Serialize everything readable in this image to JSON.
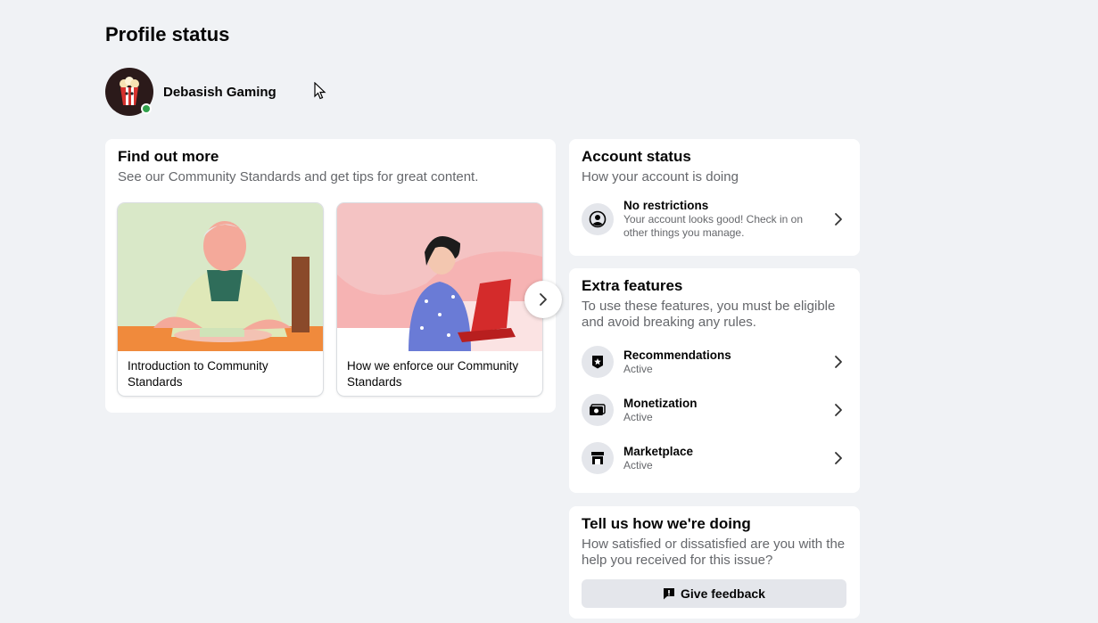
{
  "page": {
    "title": "Profile status"
  },
  "profile": {
    "name": "Debasish Gaming",
    "status_color": "#31a24c"
  },
  "find_out_more": {
    "title": "Find out more",
    "subtitle": "See our Community Standards and get tips for great content.",
    "tiles": [
      {
        "label": "Introduction to Community Standards",
        "image": "elderly-man-reading-illustration"
      },
      {
        "label": "How we enforce our Community Standards",
        "image": "woman-laptop-illustration"
      }
    ],
    "next_icon": "chevron-right-icon"
  },
  "account_status": {
    "title": "Account status",
    "subtitle": "How your account is doing",
    "item": {
      "title": "No restrictions",
      "description": "Your account looks good! Check in on other things you manage.",
      "icon": "user-circle-icon"
    }
  },
  "extra_features": {
    "title": "Extra features",
    "subtitle": "To use these features, you must be eligible and avoid breaking any rules.",
    "items": [
      {
        "title": "Recommendations",
        "status": "Active",
        "icon": "badge-star-icon"
      },
      {
        "title": "Monetization",
        "status": "Active",
        "icon": "money-icon"
      },
      {
        "title": "Marketplace",
        "status": "Active",
        "icon": "storefront-icon"
      }
    ]
  },
  "feedback": {
    "title": "Tell us how we're doing",
    "subtitle": "How satisfied or dissatisfied are you with the help you received for this issue?",
    "button_label": "Give feedback",
    "button_icon": "feedback-icon"
  },
  "colors": {
    "background": "#f0f2f5",
    "card": "#ffffff",
    "secondary_text": "#65676b",
    "icon_bg": "#e4e6eb"
  }
}
